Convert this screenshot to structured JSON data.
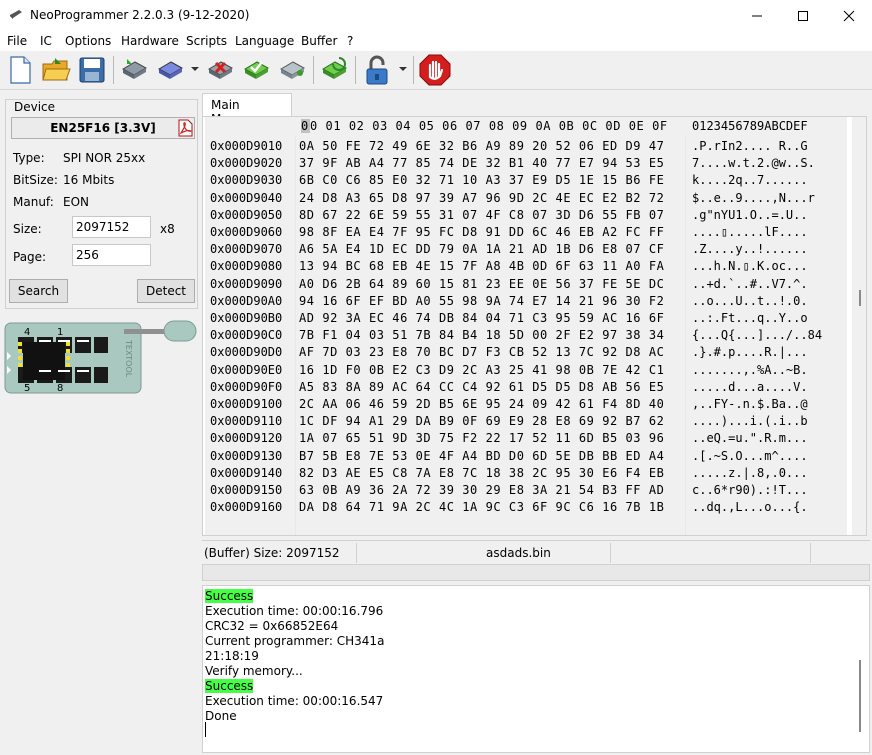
{
  "window": {
    "title": "NeoProgrammer 2.2.0.3 (9-12-2020)"
  },
  "menu": [
    "File",
    "IC",
    "Options",
    "Hardware",
    "Scripts",
    "Language",
    "Buffer",
    "?"
  ],
  "toolbar": {
    "icons": [
      "new-file-icon",
      "open-folder-icon",
      "save-disk-icon",
      "read-chip-icon",
      "write-chip-icon",
      "erase-chip-icon",
      "verify-chip-icon",
      "blank-check-icon",
      "auto-program-icon",
      "lock-icon",
      "stop-icon"
    ]
  },
  "device": {
    "caption": "Device",
    "chip": "EN25F16 [3.3V]",
    "type_label": "Type:",
    "type_value": "SPI NOR  25xx",
    "bitsize_label": "BitSize:",
    "bitsize_value": "16 Mbits",
    "manuf_label": "Manuf:",
    "manuf_value": "EON",
    "size_label": "Size:",
    "size_value": "2097152",
    "size_unit": "x8",
    "page_label": "Page:",
    "page_value": "256",
    "search_button": "Search",
    "detect_button": "Detect",
    "socket_pins": {
      "p4": "4",
      "p1": "1",
      "p5": "5",
      "p8": "8"
    },
    "socket_brand": "TEXTOOL"
  },
  "hex": {
    "tab": "Main Memory",
    "cursor_col": "0",
    "columns_rest": [
      "0",
      "01",
      "02",
      "03",
      "04",
      "05",
      "06",
      "07",
      "08",
      "09",
      "0A",
      "0B",
      "0C",
      "0D",
      "0E",
      "0F"
    ],
    "ascii_header": "0123456789ABCDEF",
    "rows": [
      {
        "addr": "0x000D9010",
        "bytes": "0A 50 FE 72 49 6E 32 B6 A9 89 20 52 06 ED D9 47",
        "ascii": ".P.rIn2.... R..G"
      },
      {
        "addr": "0x000D9020",
        "bytes": "37 9F AB A4 77 85 74 DE 32 B1 40 77 E7 94 53 E5",
        "ascii": "7....w.t.2.@w..S."
      },
      {
        "addr": "0x000D9030",
        "bytes": "6B C0 C6 85 E0 32 71 10 A3 37 E9 D5 1E 15 B6 FE",
        "ascii": "k....2q..7......"
      },
      {
        "addr": "0x000D9040",
        "bytes": "24 D8 A3 65 D8 97 39 A7 96 9D 2C 4E EC E2 B2 72",
        "ascii": "$..e..9....,N...r"
      },
      {
        "addr": "0x000D9050",
        "bytes": "8D 67 22 6E 59 55 31 07 4F C8 07 3D D6 55 FB 07",
        "ascii": ".g\"nYU1.O..=.U.."
      },
      {
        "addr": "0x000D9060",
        "bytes": "98 8F EA E4 7F 95 FC D8 91 DD 6C 46 EB A2 FC FF",
        "ascii": "....▯.....lF...."
      },
      {
        "addr": "0x000D9070",
        "bytes": "A6 5A E4 1D EC DD 79 0A 1A 21 AD 1B D6 E8 07 CF",
        "ascii": ".Z....y..!......"
      },
      {
        "addr": "0x000D9080",
        "bytes": "13 94 BC 68 EB 4E 15 7F A8 4B 0D 6F 63 11 A0 FA",
        "ascii": "...h.N.▯.K.oc..."
      },
      {
        "addr": "0x000D9090",
        "bytes": "A0 D6 2B 64 89 60 15 81 23 EE 0E 56 37 FE 5E DC",
        "ascii": "..+d.`..#..V7.^."
      },
      {
        "addr": "0x000D90A0",
        "bytes": "94 16 6F EF BD A0 55 98 9A 74 E7 14 21 96 30 F2",
        "ascii": "..o...U..t..!.0."
      },
      {
        "addr": "0x000D90B0",
        "bytes": "AD 92 3A EC 46 74 DB 84 04 71 C3 95 59 AC 16 6F",
        "ascii": "..:.Ft...q..Y..o"
      },
      {
        "addr": "0x000D90C0",
        "bytes": "7B F1 04 03 51 7B 84 B4 18 5D 00 2F E2 97 38 34",
        "ascii": "{...Q{...].../..84"
      },
      {
        "addr": "0x000D90D0",
        "bytes": "AF 7D 03 23 E8 70 BC D7 F3 CB 52 13 7C 92 D8 AC",
        "ascii": ".}.#.p....R.|..."
      },
      {
        "addr": "0x000D90E0",
        "bytes": "16 1D F0 0B E2 C3 D9 2C A3 25 41 98 0B 7E 42 C1",
        "ascii": ".......,.%A..~B."
      },
      {
        "addr": "0x000D90F0",
        "bytes": "A5 83 8A 89 AC 64 CC C4 92 61 D5 D5 D8 AB 56 E5",
        "ascii": ".....d...a....V."
      },
      {
        "addr": "0x000D9100",
        "bytes": "2C AA 06 46 59 2D B5 6E 95 24 09 42 61 F4 8D 40",
        "ascii": ",..FY-.n.$.Ba..@"
      },
      {
        "addr": "0x000D9110",
        "bytes": "1C DF 94 A1 29 DA B9 0F 69 E9 28 E8 69 92 B7 62",
        "ascii": "....)...i.(.i..b"
      },
      {
        "addr": "0x000D9120",
        "bytes": "1A 07 65 51 9D 3D 75 F2 22 17 52 11 6D B5 03 96",
        "ascii": "..eQ.=u.\".R.m..."
      },
      {
        "addr": "0x000D9130",
        "bytes": "B7 5B E8 7E 53 0E 4F A4 BD D0 6D 5E DB BB ED A4",
        "ascii": ".[.~S.O...m^...."
      },
      {
        "addr": "0x000D9140",
        "bytes": "82 D3 AE E5 C8 7A E8 7C 18 38 2C 95 30 E6 F4 EB",
        "ascii": ".....z.|.8,.0..."
      },
      {
        "addr": "0x000D9150",
        "bytes": "63 0B A9 36 2A 72 39 30 29 E8 3A 21 54 B3 FF AD",
        "ascii": "c..6*r90).:!T..."
      },
      {
        "addr": "0x000D9160",
        "bytes": "DA D8 64 71 9A 2C 4C 1A 9C C3 6F 9C C6 16 7B 1B",
        "ascii": "..dq.,L...o...{."
      }
    ]
  },
  "status": {
    "buffer_size": "(Buffer) Size: 2097152",
    "filename": "asdads.bin"
  },
  "log": [
    {
      "text": "Success",
      "ok": true
    },
    {
      "text": "Execution time: 00:00:16.796",
      "ok": false
    },
    {
      "text": "CRC32 = 0x66852E64",
      "ok": false
    },
    {
      "text": "Current programmer: CH341a",
      "ok": false
    },
    {
      "text": "21:18:19",
      "ok": false
    },
    {
      "text": "Verify memory...",
      "ok": false
    },
    {
      "text": "Success",
      "ok": true
    },
    {
      "text": "Execution time: 00:00:16.547",
      "ok": false
    },
    {
      "text": "Done",
      "ok": false
    }
  ]
}
